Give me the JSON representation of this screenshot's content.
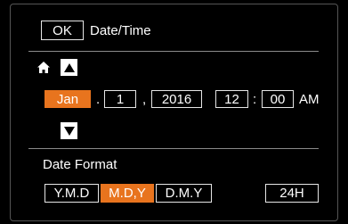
{
  "header": {
    "ok_label": "OK",
    "title": "Date/Time"
  },
  "date_time": {
    "month": "Jan",
    "day": "1",
    "year": "2016",
    "hour": "12",
    "minute": "00",
    "ampm": "AM",
    "sep_dot": ".",
    "sep_comma": ",",
    "sep_colon": ":"
  },
  "icons": {
    "home": "home-icon",
    "up": "arrow-up-icon",
    "down": "arrow-down-icon"
  },
  "date_format": {
    "label": "Date Format",
    "options": [
      "Y.M.D",
      "M.D,Y",
      "D.M.Y"
    ],
    "selected": "M.D,Y",
    "clock_option": "24H"
  },
  "colors": {
    "accent": "#e8741e",
    "background": "#000000",
    "text": "#ffffff"
  }
}
